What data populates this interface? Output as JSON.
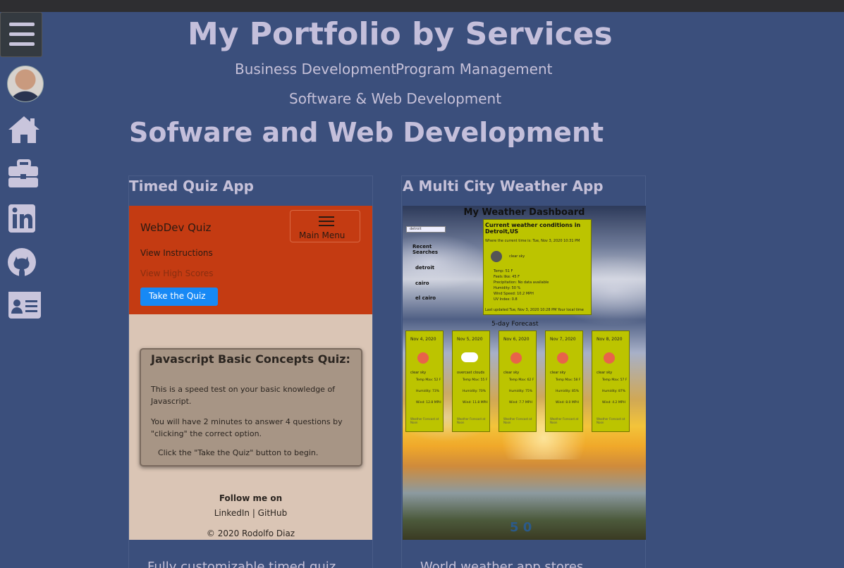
{
  "header": {
    "title": "My Portfolio by Services",
    "services": [
      "Business Development",
      "Program Management",
      "Software & Web Development"
    ]
  },
  "section": {
    "title": "Sofware and Web Development"
  },
  "sidebar": {
    "icons": [
      "menu-icon",
      "avatar",
      "home-icon",
      "briefcase-icon",
      "linkedin-icon",
      "github-icon",
      "contact-card-icon"
    ]
  },
  "cards": [
    {
      "title": "Timed Quiz App",
      "description": "Fully customizable timed quiz",
      "preview": {
        "brand": "WebDev Quiz",
        "menu_label": "Main Menu",
        "link_instructions": "View Instructions",
        "link_scores": "View High Scores",
        "start_button": "Take the Quiz",
        "box_title": "Javascript Basic Concepts Quiz:",
        "box_p1": "This is a speed test on your basic knowledge of Javascript.",
        "box_p2": "You will have 2 minutes to answer 4 questions by \"clicking\" the correct option.",
        "box_p3": "Click the \"Take the Quiz\" button to begin.",
        "follow": "Follow me on",
        "links": "LinkedIn | GitHub",
        "copyright": "© 2020 Rodolfo Diaz"
      }
    },
    {
      "title": "A Multi City Weather App",
      "description": "World weather app stores",
      "preview": {
        "title": "My Weather Dashboard",
        "search_value": "detroit",
        "recent_label": "Recent Searches",
        "cities": [
          "detroit",
          "cairo",
          "el cairo"
        ],
        "current_title": "Current weather conditions in Detroit,US",
        "current_time": "Where the current time is: Tue, Nov 3, 2020 10:31 PM",
        "condition": "clear sky",
        "current_list": [
          "Temp: 51 F",
          "Feels like: 45 F",
          "Precipitation: No data available",
          "Humidity: 50 %",
          "Wind Speed: 10.2 MPH",
          "UV Index: 0.8"
        ],
        "updated": "Last updated Tue, Nov 3, 2020 10:28 PM Your local time",
        "forecast_label": "5-day Forecast",
        "days": [
          {
            "date": "Nov 4, 2020",
            "desc": "clear sky",
            "temp": "Temp Max: 52 F",
            "hum": "Humidity: 73%",
            "wind": "Wind: 12.8 MPH",
            "icon": "sun"
          },
          {
            "date": "Nov 5, 2020",
            "desc": "overcast clouds",
            "temp": "Temp Max: 55 F",
            "hum": "Humidity: 70%",
            "wind": "Wind: 11.8 MPH",
            "icon": "cloud"
          },
          {
            "date": "Nov 6, 2020",
            "desc": "clear sky",
            "temp": "Temp Max: 62 F",
            "hum": "Humidity: 75%",
            "wind": "Wind: 7.7 MPH",
            "icon": "sun"
          },
          {
            "date": "Nov 7, 2020",
            "desc": "clear sky",
            "temp": "Temp Max: 58 F",
            "hum": "Humidity: 85%",
            "wind": "Wind: 8.0 MPH",
            "icon": "sun"
          },
          {
            "date": "Nov 8, 2020",
            "desc": "clear sky",
            "temp": "Temp Max: 57 F",
            "hum": "Humidity: 87%",
            "wind": "Wind: 4.2 MPH",
            "icon": "sun"
          }
        ],
        "day_footer": "Weather Forecast at Noon",
        "logo": "5 0"
      }
    }
  ]
}
